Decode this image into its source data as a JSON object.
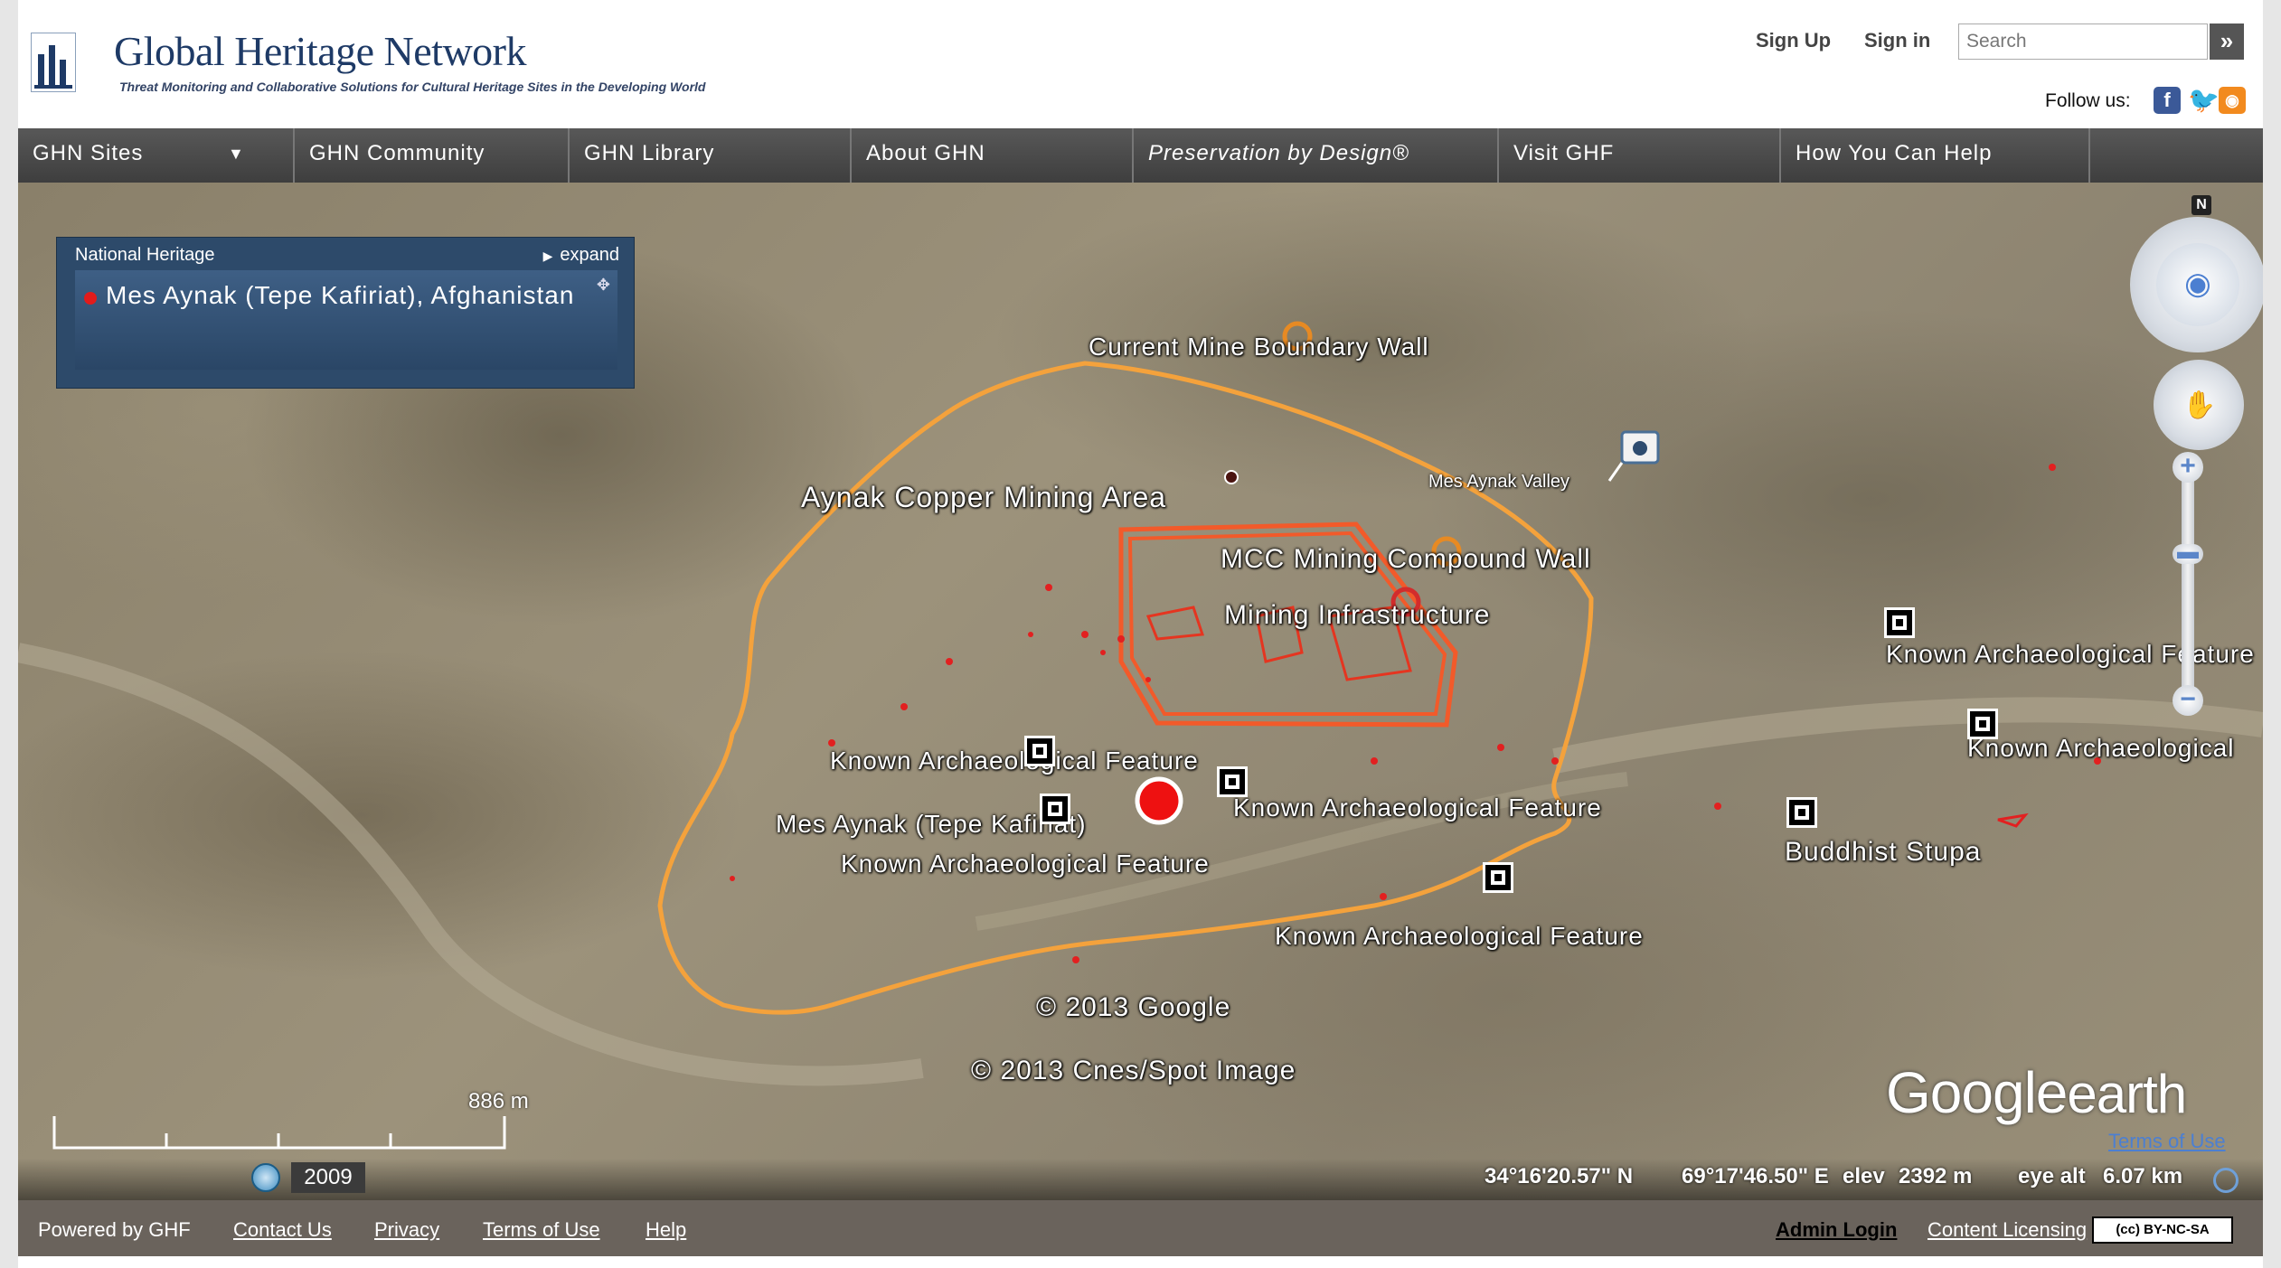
{
  "header": {
    "logo_title": "Global Heritage Network",
    "logo_tagline": "Threat Monitoring and Collaborative Solutions for Cultural Heritage Sites in the Developing World",
    "sign_up": "Sign Up",
    "sign_in": "Sign in",
    "search_placeholder": "Search",
    "search_button": "»",
    "follow_label": "Follow us:",
    "social": [
      "facebook-icon",
      "twitter-icon",
      "rss-icon"
    ]
  },
  "nav": [
    {
      "label": "GHN Sites",
      "has_dropdown": true
    },
    {
      "label": "GHN Community"
    },
    {
      "label": "GHN Library"
    },
    {
      "label": "About GHN"
    },
    {
      "label": "Preservation by Design®"
    },
    {
      "label": "Visit GHF"
    },
    {
      "label": "How You Can Help"
    }
  ],
  "info_panel": {
    "category": "National Heritage",
    "expand": "expand",
    "site_name": "Mes Aynak (Tepe Kafiriat), Afghanistan"
  },
  "map_labels": {
    "boundary_wall": "Current Mine Boundary Wall",
    "mining_area": "Aynak Copper Mining Area",
    "valley": "Mes Aynak Valley",
    "compound_wall": "MCC Mining Compound Wall",
    "infrastructure": "Mining Infrastructure",
    "feature": "Known Archaeological Feature",
    "feature_truncated": "Known Archaeological",
    "site": "Mes Aynak (Tepe Kafiriat)",
    "stupa": "Buddhist Stupa",
    "copyright_google": "© 2013 Google",
    "copyright_cnes": "© 2013 Cnes/Spot Image"
  },
  "map_controls": {
    "north": "N",
    "zoom_in": "+",
    "zoom_out": "−",
    "zoom_level": 0.3
  },
  "status": {
    "scale": "886 m",
    "year": "2009",
    "lat": "34°16'20.57\" N",
    "lon": "69°17'46.50\" E",
    "elev_label": "elev",
    "elev": "2392 m",
    "eye_label": "eye alt",
    "eye_alt": "6.07 km",
    "terms": "Terms of Use"
  },
  "earth_logo": {
    "brand": "Google",
    "product": "earth"
  },
  "footer": {
    "powered_by": "Powered by GHF",
    "links": [
      "Contact Us",
      "Privacy",
      "Terms of Use",
      "Help"
    ],
    "admin_login": "Admin Login",
    "content_licensing": "Content Licensing",
    "license_badge": "BY-NC-SA"
  },
  "colors": {
    "nav_bg": "#4a4a4a",
    "panel_bg": "#2d4a6a",
    "boundary": "#f4a23c",
    "compound": "#f25a2a",
    "site_marker": "#e21b1b",
    "footer_bg": "#6a635c"
  }
}
